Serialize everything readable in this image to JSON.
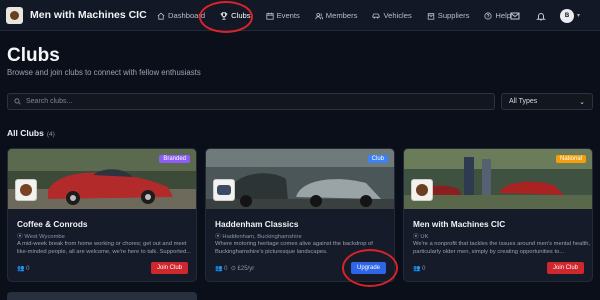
{
  "app": {
    "name": "Men with Machines CIC"
  },
  "nav": {
    "items": [
      {
        "label": "Dashboard",
        "icon": "home-icon"
      },
      {
        "label": "Clubs",
        "icon": "trophy-icon"
      },
      {
        "label": "Events",
        "icon": "calendar-icon"
      },
      {
        "label": "Members",
        "icon": "users-icon"
      },
      {
        "label": "Vehicles",
        "icon": "car-icon"
      },
      {
        "label": "Suppliers",
        "icon": "box-icon"
      },
      {
        "label": "Help",
        "icon": "help-icon"
      }
    ],
    "active": "Clubs"
  },
  "user": {
    "initial": "B"
  },
  "page": {
    "title": "Clubs",
    "subtitle": "Browse and join clubs to connect with fellow enthusiasts"
  },
  "search": {
    "placeholder": "Search clubs..."
  },
  "filter": {
    "selected": "All Types"
  },
  "section": {
    "title": "All Clubs",
    "count": "(4)"
  },
  "colors": {
    "accent_red": "#d0262d",
    "accent_blue": "#2f66e8",
    "branded": "#8b5cf6",
    "club": "#3b82f6",
    "national": "#f59e0b"
  },
  "cards": [
    {
      "title": "Coffee & Conrods",
      "tag": "Branded",
      "location": "West Wycombe",
      "description": "A mid-week break from home working or chores; get out and meet like-minded people, all are welcome, we're here to talk. Supported...",
      "members": "0",
      "price": "",
      "button": "Join Club"
    },
    {
      "title": "Haddenham Classics",
      "tag": "Club",
      "location": "Haddenham, Buckinghamshire",
      "description": "Where motoring heritage comes alive against the backdrop of Buckinghamshire's picturesque landscapes.",
      "members": "0",
      "price": "£25/yr",
      "button": "Upgrade"
    },
    {
      "title": "Men with Machines CIC",
      "tag": "National",
      "location": "UK",
      "description": "We're a nonprofit that tackles the issues around men's mental health, particularly older men, simply by creating opportunities to...",
      "members": "0",
      "price": "",
      "button": "Join Club"
    }
  ]
}
